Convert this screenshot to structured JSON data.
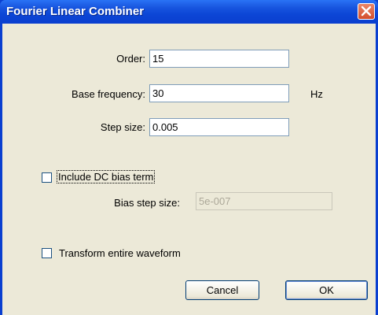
{
  "window": {
    "title": "Fourier Linear Combiner"
  },
  "fields": {
    "order": {
      "label": "Order:",
      "value": "15"
    },
    "base_frequency": {
      "label": "Base frequency:",
      "value": "30",
      "unit": "Hz"
    },
    "step_size": {
      "label": "Step size:",
      "value": "0.005"
    }
  },
  "dc_bias": {
    "label": "Include DC bias term",
    "checked": false
  },
  "bias_step": {
    "label": "Bias step size:",
    "value": "5e-007"
  },
  "transform": {
    "label": "Transform entire waveform",
    "checked": false
  },
  "buttons": {
    "cancel": "Cancel",
    "ok": "OK"
  },
  "icons": {
    "close": "close-icon"
  },
  "colors": {
    "titlebar": "#0a3fcf",
    "close_button": "#d34d2b",
    "dialog_bg": "#ece9d8"
  }
}
